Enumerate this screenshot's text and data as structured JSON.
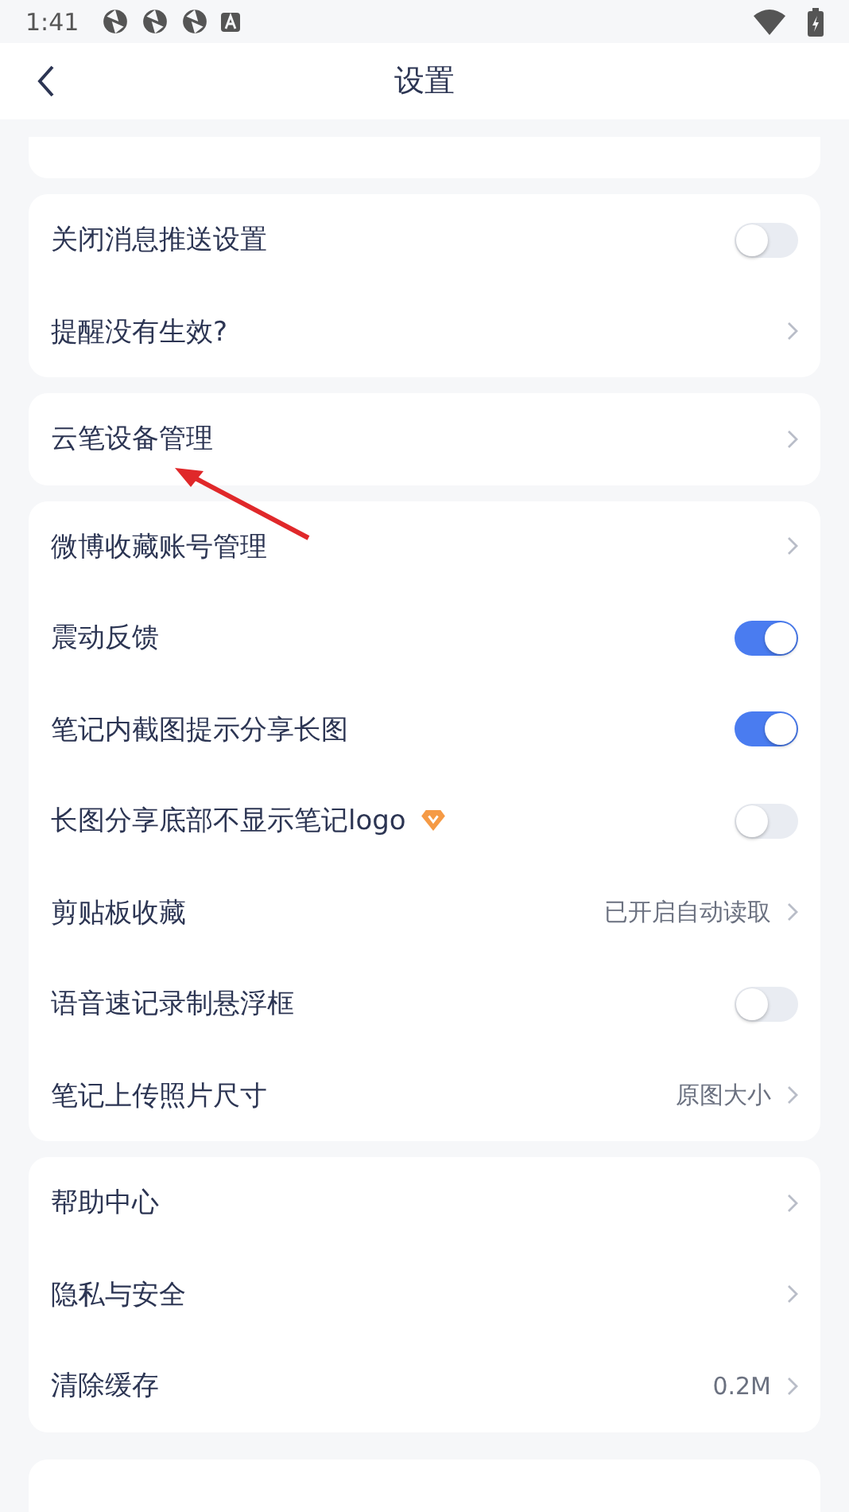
{
  "status_bar": {
    "time": "1:41"
  },
  "header": {
    "title": "设置"
  },
  "groups": [
    {
      "rows": [
        {
          "kind": "toggle",
          "label": "关闭消息推送设置",
          "on": false
        },
        {
          "kind": "link",
          "label": "提醒没有生效?"
        }
      ]
    },
    {
      "rows": [
        {
          "kind": "link",
          "label": "云笔设备管理"
        }
      ]
    },
    {
      "rows": [
        {
          "kind": "link",
          "label": "微博收藏账号管理"
        },
        {
          "kind": "toggle",
          "label": "震动反馈",
          "on": true
        },
        {
          "kind": "toggle",
          "label": "笔记内截图提示分享长图",
          "on": true
        },
        {
          "kind": "toggle",
          "label": "长图分享底部不显示笔记logo",
          "on": false,
          "vip": true
        },
        {
          "kind": "link",
          "label": "剪贴板收藏",
          "value": "已开启自动读取"
        },
        {
          "kind": "toggle",
          "label": "语音速记录制悬浮框",
          "on": false
        },
        {
          "kind": "link",
          "label": "笔记上传照片尺寸",
          "value": "原图大小"
        }
      ]
    },
    {
      "rows": [
        {
          "kind": "link",
          "label": "帮助中心"
        },
        {
          "kind": "link",
          "label": "隐私与安全"
        },
        {
          "kind": "link",
          "label": "清除缓存",
          "value": "0.2M"
        }
      ]
    }
  ]
}
